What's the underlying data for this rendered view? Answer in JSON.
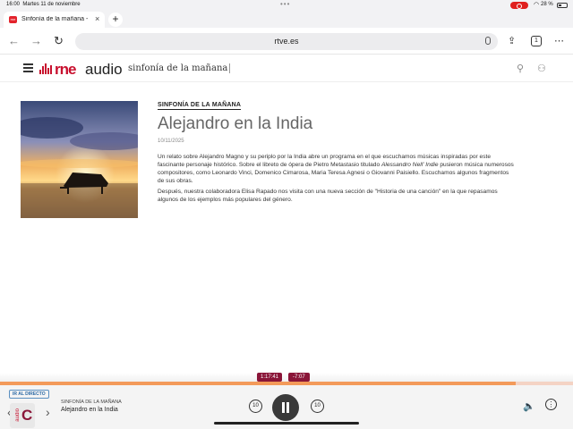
{
  "status_bar": {
    "time": "16:00",
    "date": "Martes 11 de noviembre",
    "battery": "28 %"
  },
  "browser": {
    "tab_title": "Sinfonía de la mañana -",
    "favicon_text": "rne",
    "close_label": "×",
    "new_tab_label": "+",
    "back_icon": "←",
    "forward_icon": "→",
    "reload_icon": "↻",
    "url": "rtve.es",
    "share_icon": "⇪",
    "tab_count": "1",
    "more_icon": "⋯"
  },
  "site": {
    "logo_rne": "rne",
    "logo_audio": "audio",
    "subtitle": "sinfonía de la mañana",
    "search_icon": "⚲",
    "user_icon": "⚇"
  },
  "episode": {
    "section": "SINFONÍA DE LA MAÑANA",
    "title": "Alejandro en la India",
    "date": "10/11/2025",
    "paragraph1_a": "Un relato sobre Alejandro Magno y su periplo por la India abre un programa en el que escuchamos músicas inspiradas por este fascinante personaje histórico. Sobre el libreto de ópera de Pietro Metastasio titulado ",
    "paragraph1_italic": "Alessandro Nell' Indie",
    "paragraph1_b": " pusieron música numerosos compositores, como Leonardo Vinci, Domenico Cimarosa, Maria Teresa Agnesi o Giovanni Paisiello. Escuchamos algunos fragmentos de sus obras.",
    "paragraph2": "Después, nuestra colaboradora Elisa Rapado nos visita con una nueva sección de \"Historia de una canción\" en la que repasamos algunos de los ejemplos más populares del género."
  },
  "player": {
    "live_label": "IR AL DIRECTO",
    "elapsed": "1:17:41",
    "remaining": "-7:07",
    "progress": 0.9,
    "program": "SINFONÍA DE LA MAÑANA",
    "title": "Alejandro en la India",
    "skip_back": "10",
    "skip_forward": "10",
    "mini_logo_letter": "C",
    "mini_logo_side": "audio",
    "prev_arrow": "‹",
    "next_arrow": "›",
    "volume_icon": "🔈",
    "more_icon": "⋮"
  },
  "colors": {
    "brand_red": "#c8102e",
    "player_accent": "#8a1538",
    "progress": "#f39a5a"
  }
}
